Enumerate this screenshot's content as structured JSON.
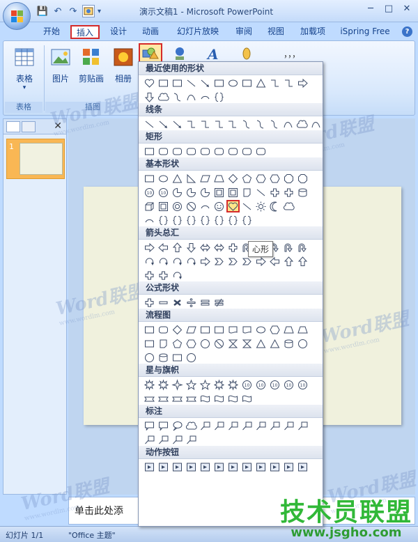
{
  "window": {
    "title": "演示文稿1 - Microsoft PowerPoint"
  },
  "qat": {
    "save": "💾",
    "undo": "↶",
    "redo": "↷",
    "caret": "▾"
  },
  "window_controls": {
    "minimize": "─",
    "maximize": "□",
    "close": "✕"
  },
  "tabs": [
    {
      "label": "开始"
    },
    {
      "label": "插入"
    },
    {
      "label": "设计"
    },
    {
      "label": "动画"
    },
    {
      "label": "幻灯片放映"
    },
    {
      "label": "审阅"
    },
    {
      "label": "视图"
    },
    {
      "label": "加载项"
    },
    {
      "label": "iSpring Free"
    }
  ],
  "help": "?",
  "ribbon": {
    "table_label": "表格",
    "table_group": "表格",
    "picture_label": "图片",
    "clipart_label": "剪贴画",
    "album_label": "相册",
    "illustrations_group": "插图",
    "ellipsis": "，，，"
  },
  "left_panel": {
    "close": "✕",
    "slide_number": "1"
  },
  "notes": {
    "placeholder": "单击此处添"
  },
  "status": {
    "slide": "幻灯片 1/1",
    "theme": "\"Office 主题\""
  },
  "watermark": {
    "text": "Word联盟",
    "url": "www.wordlm.com"
  },
  "brand": {
    "title": "技术员联盟",
    "url": "www.jsgho.com"
  },
  "shapes_menu": {
    "sections": [
      {
        "title": "最近使用的形状"
      },
      {
        "title": "线条"
      },
      {
        "title": "矩形"
      },
      {
        "title": "基本形状"
      },
      {
        "title": "箭头总汇"
      },
      {
        "title": "公式形状"
      },
      {
        "title": "流程图"
      },
      {
        "title": "星与旗帜"
      },
      {
        "title": "标注"
      },
      {
        "title": "动作按钮"
      }
    ],
    "tooltip": "心形"
  },
  "colors": {
    "accent_red": "#d52a2a",
    "brand_green": "#31b838",
    "ribbon_blue": "#bfdbff"
  }
}
